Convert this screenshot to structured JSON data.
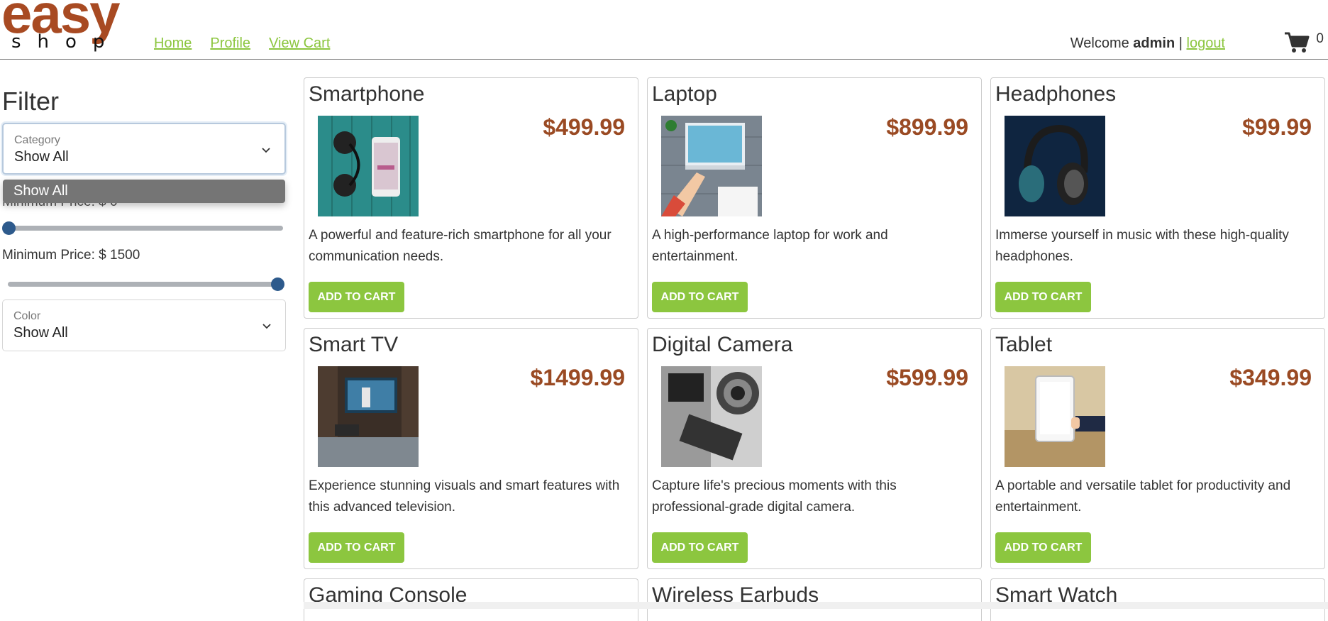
{
  "header": {
    "logo_brand": "easy",
    "logo_sub": "shop",
    "nav": [
      "Home",
      "Profile",
      "View Cart"
    ],
    "welcome_prefix": "Welcome ",
    "username": "admin",
    "separator": " | ",
    "logout": "logout",
    "cart_count": "0",
    "cart_icon": "shopping-cart-icon"
  },
  "sidebar": {
    "title": "Filter",
    "category": {
      "label": "Category",
      "value": "Show All",
      "open_option": "Show All"
    },
    "min_price_label": "Minimum Price: $ 0",
    "max_price_label": "Minimum Price: $ 1500",
    "min_price_value": 0,
    "max_price_value": 1500,
    "color": {
      "label": "Color",
      "value": "Show All"
    }
  },
  "products": [
    {
      "name": "Smartphone",
      "price": "$499.99",
      "description": "A powerful and feature-rich smartphone for all your communication needs.",
      "button": "ADD TO CART"
    },
    {
      "name": "Laptop",
      "price": "$899.99",
      "description": "A high-performance laptop for work and entertainment.",
      "button": "ADD TO CART"
    },
    {
      "name": "Headphones",
      "price": "$99.99",
      "description": "Immerse yourself in music with these high-quality headphones.",
      "button": "ADD TO CART"
    },
    {
      "name": "Smart TV",
      "price": "$1499.99",
      "description": "Experience stunning visuals and smart features with this advanced television.",
      "button": "ADD TO CART"
    },
    {
      "name": "Digital Camera",
      "price": "$599.99",
      "description": "Capture life's precious moments with this professional-grade digital camera.",
      "button": "ADD TO CART"
    },
    {
      "name": "Tablet",
      "price": "$349.99",
      "description": "A portable and versatile tablet for productivity and entertainment.",
      "button": "ADD TO CART"
    },
    {
      "name": "Gaming Console"
    },
    {
      "name": "Wireless Earbuds"
    },
    {
      "name": "Smart Watch"
    }
  ],
  "colors": {
    "accent_green": "#8cc63f",
    "price_brown": "#9a4a23",
    "logo_brown": "#a84a22",
    "slider_blue": "#2d5a8c"
  }
}
